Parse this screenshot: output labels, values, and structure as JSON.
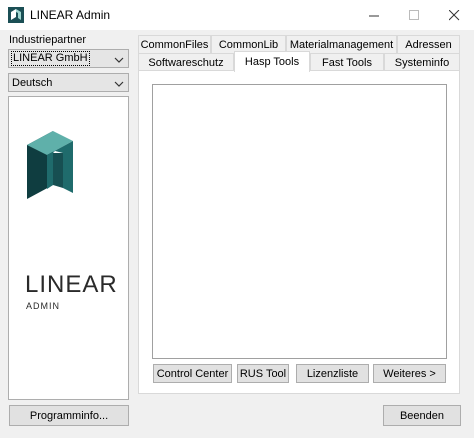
{
  "window": {
    "title": "LINEAR Admin",
    "icons": {
      "app": "linear-app-icon",
      "minimize": "minimize-icon",
      "maximize": "maximize-icon",
      "close": "close-icon"
    }
  },
  "sidebar": {
    "partner_label": "Industriepartner",
    "partner_value": "LINEAR GmbH",
    "language_value": "Deutsch",
    "logo": {
      "word": "LINEAR",
      "subword": "ADMIN",
      "colors": {
        "dark": "#0f3d40",
        "mid": "#1f6b6c",
        "light": "#5fb0aa"
      }
    },
    "programinfo_button": "Programminfo..."
  },
  "tabs": {
    "row_top": [
      "CommonFiles",
      "CommonLib",
      "Materialmanagement",
      "Adressen"
    ],
    "row_bottom": [
      "Softwareschutz",
      "Hasp Tools",
      "Fast Tools",
      "Systeminfo"
    ],
    "active": "Hasp Tools"
  },
  "hasp_tools": {
    "buttons": [
      "Control Center",
      "RUS Tool",
      "Lizenzliste",
      "Weiteres >"
    ]
  },
  "footer": {
    "exit_button": "Beenden"
  }
}
